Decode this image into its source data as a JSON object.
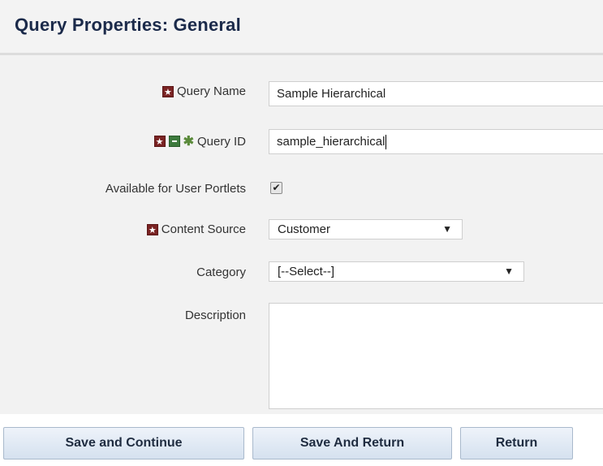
{
  "header": {
    "title": "Query Properties: General"
  },
  "form": {
    "query_name": {
      "label": "Query Name",
      "value": "Sample Hierarchical"
    },
    "query_id": {
      "label": "Query ID",
      "value": "sample_hierarchical"
    },
    "available_for_user_portlets": {
      "label": "Available for User Portlets",
      "checked": true,
      "check_glyph": "✔"
    },
    "content_source": {
      "label": "Content Source",
      "selected": "Customer"
    },
    "category": {
      "label": "Category",
      "selected": "[--Select--]"
    },
    "description": {
      "label": "Description",
      "value": ""
    }
  },
  "icons": {
    "required": "required-icon",
    "language": "language-icon",
    "unique": "unique-icon",
    "dropdown": "▼"
  },
  "buttons": {
    "save_continue": "Save and Continue",
    "save_return": "Save And Return",
    "return": "Return"
  },
  "colors": {
    "required_icon": "#7a2323",
    "green_icon": "#3d7a3d",
    "title": "#1b2a4a",
    "button_top": "#eef3fa",
    "button_bottom": "#d5e1ef"
  }
}
